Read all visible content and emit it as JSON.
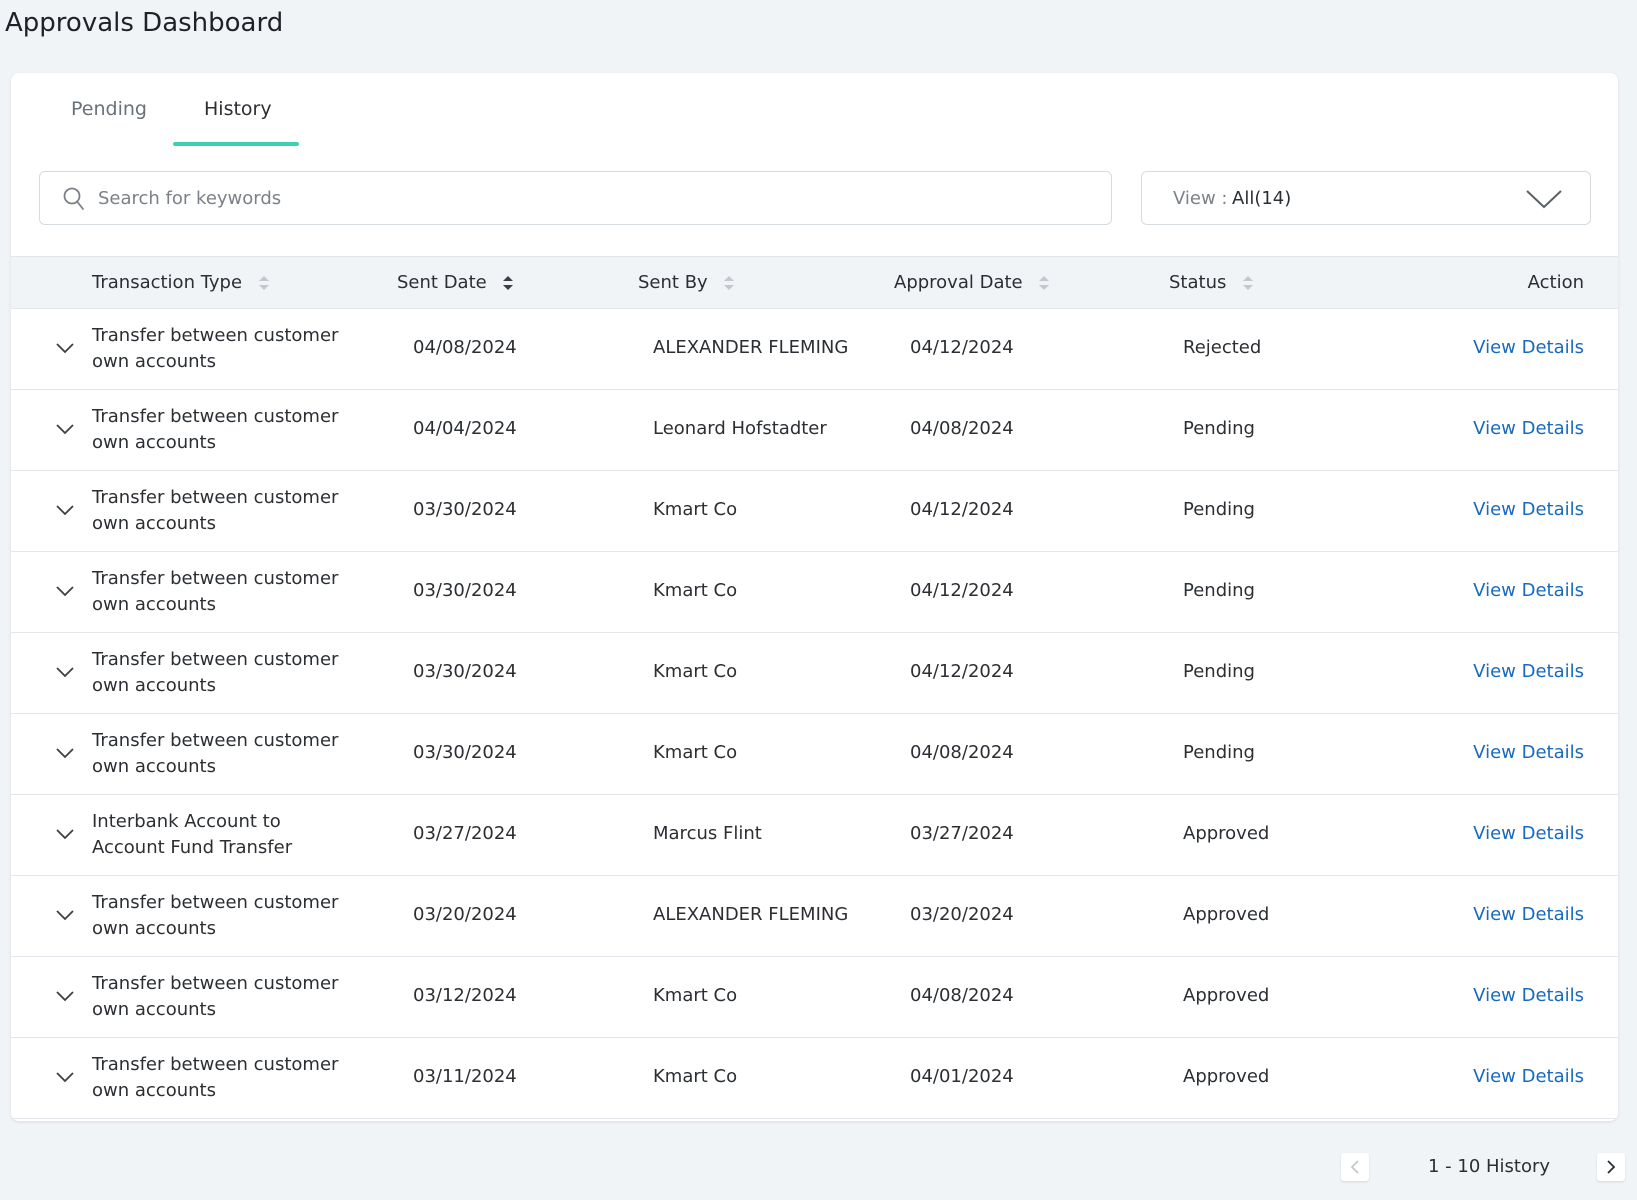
{
  "page": {
    "title": "Approvals Dashboard"
  },
  "tabs": [
    {
      "label": "Pending",
      "active": false
    },
    {
      "label": "History",
      "active": true
    }
  ],
  "search": {
    "placeholder": "Search for keywords",
    "value": ""
  },
  "view_filter": {
    "label": "View :",
    "value": "All(14)"
  },
  "table": {
    "columns": {
      "transaction_type": "Transaction Type",
      "sent_date": "Sent Date",
      "sent_by": "Sent By",
      "approval_date": "Approval Date",
      "status": "Status",
      "action": "Action"
    },
    "rows": [
      {
        "type": "Transfer between customer own accounts",
        "sent_date": "04/08/2024",
        "sent_by": "ALEXANDER FLEMING",
        "approval_date": "04/12/2024",
        "status": "Rejected",
        "action": "View Details"
      },
      {
        "type": "Transfer between customer own accounts",
        "sent_date": "04/04/2024",
        "sent_by": "Leonard Hofstadter",
        "approval_date": "04/08/2024",
        "status": "Pending",
        "action": "View Details"
      },
      {
        "type": "Transfer between customer own accounts",
        "sent_date": "03/30/2024",
        "sent_by": "Kmart Co",
        "approval_date": "04/12/2024",
        "status": "Pending",
        "action": "View Details"
      },
      {
        "type": "Transfer between customer own accounts",
        "sent_date": "03/30/2024",
        "sent_by": "Kmart Co",
        "approval_date": "04/12/2024",
        "status": "Pending",
        "action": "View Details"
      },
      {
        "type": "Transfer between customer own accounts",
        "sent_date": "03/30/2024",
        "sent_by": "Kmart Co",
        "approval_date": "04/12/2024",
        "status": "Pending",
        "action": "View Details"
      },
      {
        "type": "Transfer between customer own accounts",
        "sent_date": "03/30/2024",
        "sent_by": "Kmart Co",
        "approval_date": "04/08/2024",
        "status": "Pending",
        "action": "View Details"
      },
      {
        "type": "Interbank Account to Account Fund Transfer",
        "sent_date": "03/27/2024",
        "sent_by": "Marcus Flint",
        "approval_date": "03/27/2024",
        "status": "Approved",
        "action": "View Details"
      },
      {
        "type": "Transfer between customer own accounts",
        "sent_date": "03/20/2024",
        "sent_by": "ALEXANDER FLEMING",
        "approval_date": "03/20/2024",
        "status": "Approved",
        "action": "View Details"
      },
      {
        "type": "Transfer between customer own accounts",
        "sent_date": "03/12/2024",
        "sent_by": "Kmart Co",
        "approval_date": "04/08/2024",
        "status": "Approved",
        "action": "View Details"
      },
      {
        "type": "Transfer between customer own accounts",
        "sent_date": "03/11/2024",
        "sent_by": "Kmart Co",
        "approval_date": "04/01/2024",
        "status": "Approved",
        "action": "View Details"
      }
    ]
  },
  "pagination": {
    "summary": "1 - 10 History"
  },
  "colors": {
    "accent": "#3fd1b3",
    "link": "#1769c1",
    "background": "#f1f4f7"
  }
}
